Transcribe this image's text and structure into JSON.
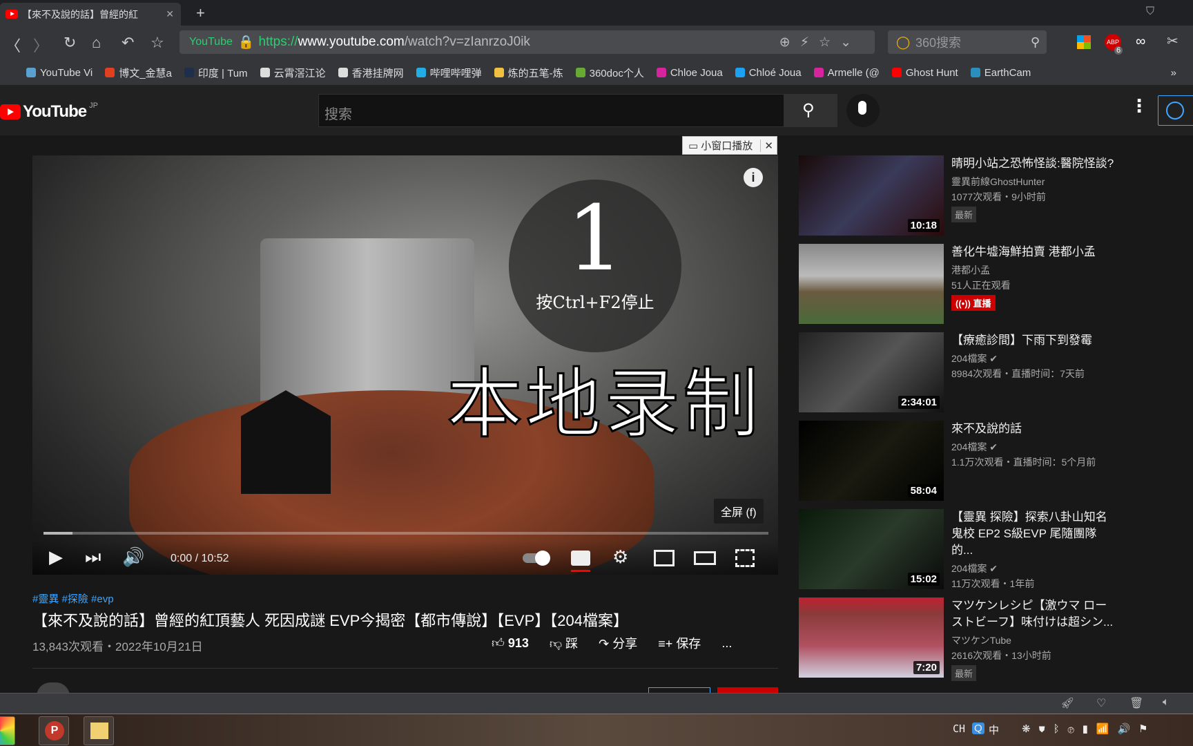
{
  "browser": {
    "tab_title": "【來不及說的話】曾經的紅",
    "url_site_label": "YouTube",
    "url_scheme": "https://",
    "url_host": "www.youtube.com",
    "url_path": "/watch?v=zIanrzoJ0ik",
    "search_placeholder": "360搜索",
    "abp_count": "6",
    "bookmarks": [
      {
        "label": "YouTube Vi",
        "color": "#5aa0d0"
      },
      {
        "label": "博文_金慧a",
        "color": "#e04020"
      },
      {
        "label": "印度 | Tum",
        "color": "#1d2f4a"
      },
      {
        "label": "云霄滘江论",
        "color": "#ddd"
      },
      {
        "label": "香港挂牌网",
        "color": "#ddd"
      },
      {
        "label": "哔哩哔哩弹",
        "color": "#23ade5"
      },
      {
        "label": "炼的五笔-炼",
        "color": "#f0c040"
      },
      {
        "label": "360doc个人",
        "color": "#6a3"
      },
      {
        "label": "Chloe Joua",
        "color": "#d6249f"
      },
      {
        "label": "Chloé Joua",
        "color": "#1da1f2"
      },
      {
        "label": "Armelle (@",
        "color": "#d6249f"
      },
      {
        "label": "Ghost Hunt",
        "color": "#f00"
      },
      {
        "label": "EarthCam",
        "color": "#2a8fbd"
      }
    ],
    "more": "»"
  },
  "youtube": {
    "logo": "YouTube",
    "region": "JP",
    "search_placeholder": "搜索"
  },
  "mini_player_label": "小窗口播放",
  "player": {
    "countdown": "1",
    "stop_hint": "按Ctrl+F2停止",
    "recording_label": "本地录制",
    "tooltip": "全屏 (f)",
    "time": "0:00 / 10:52",
    "progress_loaded": 0.04
  },
  "video": {
    "tags": "#靈異 #探險 #evp",
    "title": "【來不及說的話】曾經的紅頂藝人 死因成謎 EVP今揭密【都市傳說】【EVP】【204檔案】",
    "meta": "13,843次观看・2022年10月21日",
    "likes": "913",
    "dislike": "踩",
    "share": "分享",
    "save": "保存",
    "more": "..."
  },
  "sidebar": [
    {
      "title": "晴明小站之恐怖怪談:醫院怪談?",
      "channel": "靈異前線GhostHunter",
      "views": "1077次观看・9小时前",
      "badge": "最新",
      "duration": "10:18",
      "thumb": "linear-gradient(135deg,#1a0a0a,#3a3a5a 50%,#2a0a0a)",
      "verified": false
    },
    {
      "title": "善化牛墟海鮮拍賣 港都小孟",
      "channel": "港都小孟",
      "views": "51人正在观看",
      "live": "直播",
      "thumb": "linear-gradient(180deg,#888 0%,#bbb 40%,#6a5a40 60%,#4a6a3a)",
      "verified": false
    },
    {
      "title": "【療癒診間】下雨下到發霉",
      "channel": "204檔案",
      "views": "8984次观看・直播时间：7天前",
      "duration": "2:34:01",
      "thumb": "linear-gradient(135deg,#222,#555 50%,#111)",
      "verified": true
    },
    {
      "title": "來不及說的話",
      "channel": "204檔案",
      "views": "1.1万次观看・直播时间：5个月前",
      "duration": "58:04",
      "thumb": "linear-gradient(135deg,#000,#1a1a10 50%,#000)",
      "verified": true
    },
    {
      "title": "【靈異 探險】探索八卦山知名鬼校 EP2 S級EVP 尾隨團隊的...",
      "channel": "204檔案",
      "views": "11万次观看・1年前",
      "duration": "15:02",
      "thumb": "linear-gradient(135deg,#0a1a0a,#2a3a2a 50%,#0a0a0a)",
      "verified": true
    },
    {
      "title": "マツケンレシピ【激ウマ ローストビーフ】味付けは超シン...",
      "channel": "マツケンTube",
      "views": "2616次观看・13小时前",
      "badge": "最新",
      "duration": "7:20",
      "thumb": "linear-gradient(180deg,#c02030 0%,#8a3a3a 20%,#b05060 60%,#d0d0e0)",
      "verified": false
    }
  ],
  "tray": {
    "lang": "CH",
    "ime": "中"
  }
}
